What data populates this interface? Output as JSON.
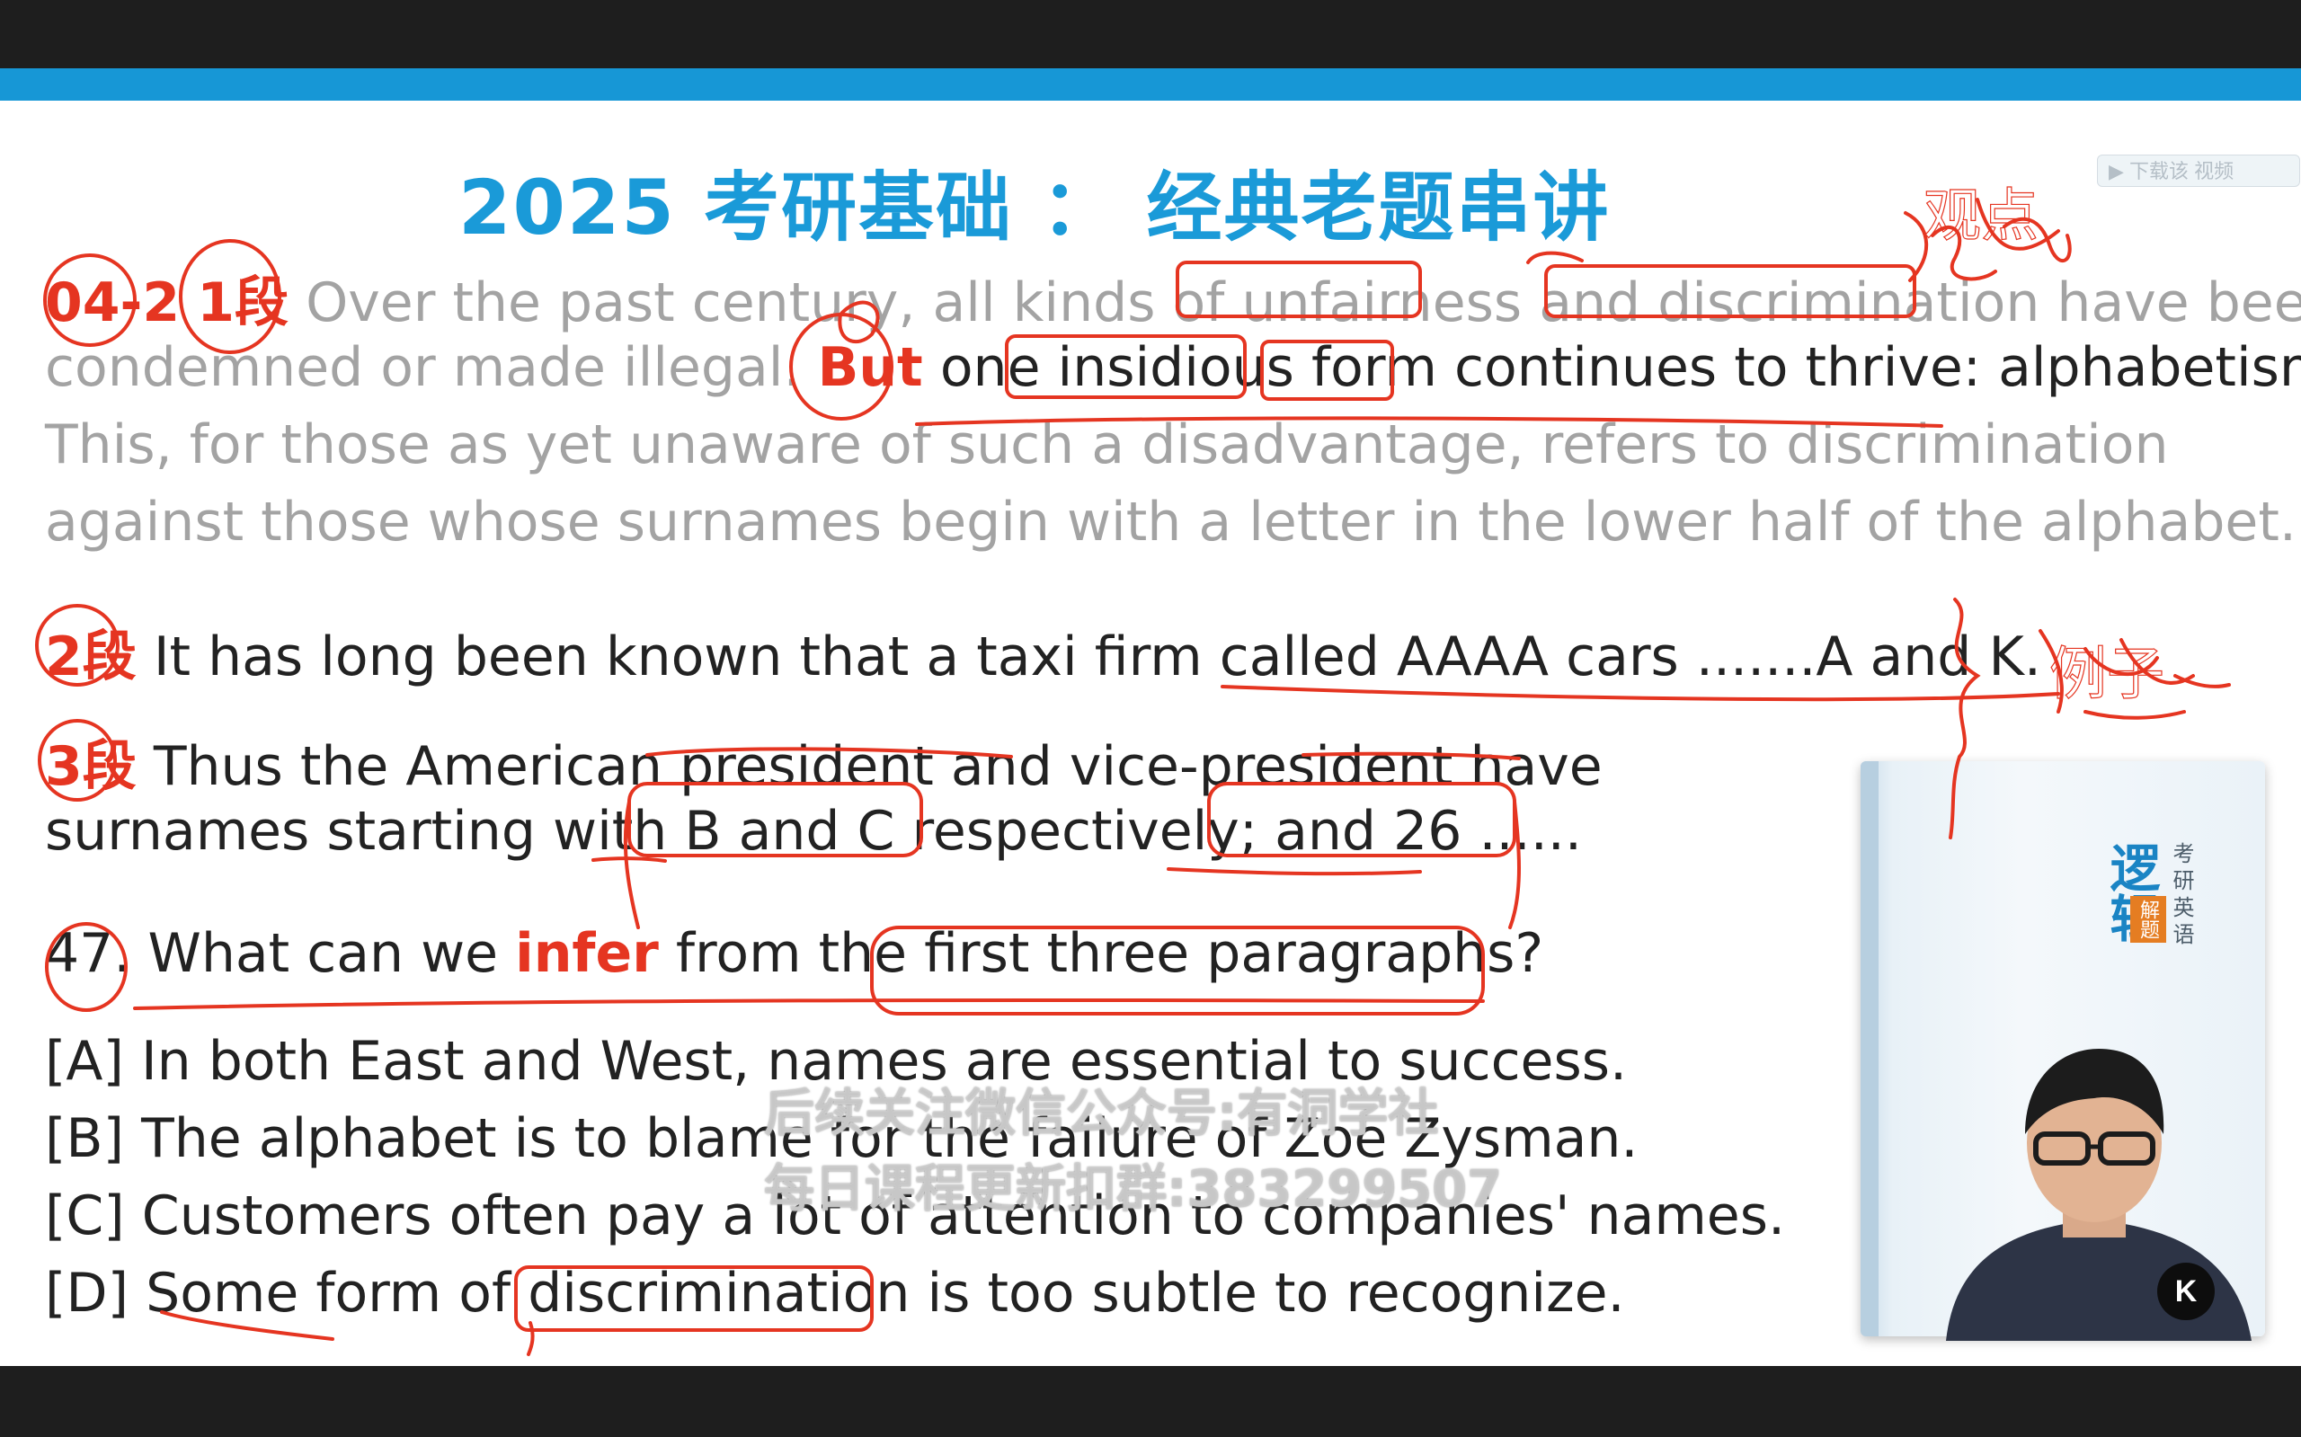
{
  "title": "2025 考研基础 ： 经典老题串讲",
  "download_button": "下载该 视频",
  "para1": {
    "tag": "04-2",
    "section": "1段",
    "line1": "Over the past century, all kinds of unfairness and discrimination have been",
    "line2_grey": "condemned or made illegal.",
    "line2_but": "But",
    "line2_dark": "one insidious form continues to thrive: alphabetism.",
    "line3": "This, for those as yet unaware of such a disadvantage, refers to discrimination",
    "line4": "against those whose surnames begin with a letter in the lower half of the alphabet."
  },
  "para2": {
    "section": "2段",
    "text": "It has long been known that a taxi firm called AAAA cars .......A and K."
  },
  "para3": {
    "section": "3段",
    "line1": "Thus the American president and vice-president have",
    "line2": "surnames starting with B and C respectively; and 26 ......"
  },
  "question": {
    "number": "47.",
    "before": "What can we",
    "keyword": "infer",
    "after": "from the first three paragraphs?"
  },
  "options": [
    {
      "label": "[A]",
      "text": "In both East and West, names are essential to success."
    },
    {
      "label": "[B]",
      "text": "The alphabet is to blame for the failure of Zoe Zysman."
    },
    {
      "label": "[C]",
      "text": "Customers often pay a lot of attention to companies' names."
    },
    {
      "label": "[D]",
      "text": "Some form of discrimination is too subtle to recognize."
    }
  ],
  "watermark": {
    "line1": "后续关注微信公众号:有洞学社",
    "line2": "每日课程更新扣群:383299507"
  },
  "handwritten": {
    "top_right": "观点",
    "right": "例子"
  },
  "book": {
    "title": "逻辑",
    "side": "考研英语",
    "tag": "解题"
  },
  "logo": "K",
  "colors": {
    "accent_blue": "#1a9ad8",
    "annotation_red": "#e53521",
    "bar_blue": "#1797d6"
  }
}
